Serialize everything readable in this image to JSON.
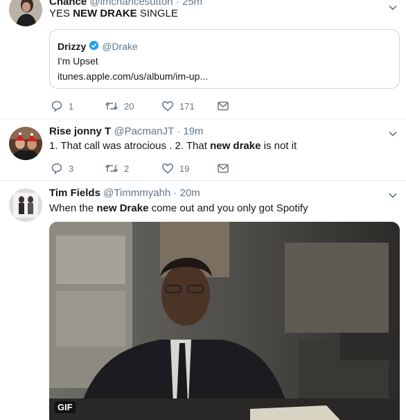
{
  "tweets": [
    {
      "name": "Chance",
      "handle": "@imchancesutton",
      "time": "25m",
      "text_parts": [
        "YES ",
        "NEW DRAKE",
        " SINGLE"
      ],
      "quote": {
        "name": "Drizzy",
        "handle": "@Drake",
        "text": "I'm Upset",
        "link": "itunes.apple.com/us/album/im-up..."
      },
      "replies": "1",
      "retweets": "20",
      "likes": "171"
    },
    {
      "name": "Rise jonny T",
      "handle": "@PacmanJT",
      "time": "19m",
      "text_parts": [
        "1. That call was atrocious . 2. That ",
        "new drake",
        " is not it"
      ],
      "replies": "3",
      "retweets": "2",
      "likes": "19"
    },
    {
      "name": "Tim Fields",
      "handle": "@Timmmyahh",
      "time": "20m",
      "text_parts": [
        "When the ",
        "new Drake",
        " come out and you only got Spotify"
      ],
      "media_badge": "GIF"
    }
  ],
  "icons": {
    "reply": "reply-icon",
    "retweet": "retweet-icon",
    "like": "heart-icon",
    "dm": "envelope-icon",
    "more": "chevron-down-icon",
    "verified": "verified-badge-icon"
  },
  "colors": {
    "text": "#14171a",
    "muted": "#657786",
    "border": "#e6ecf0",
    "verified": "#1da1f2"
  }
}
